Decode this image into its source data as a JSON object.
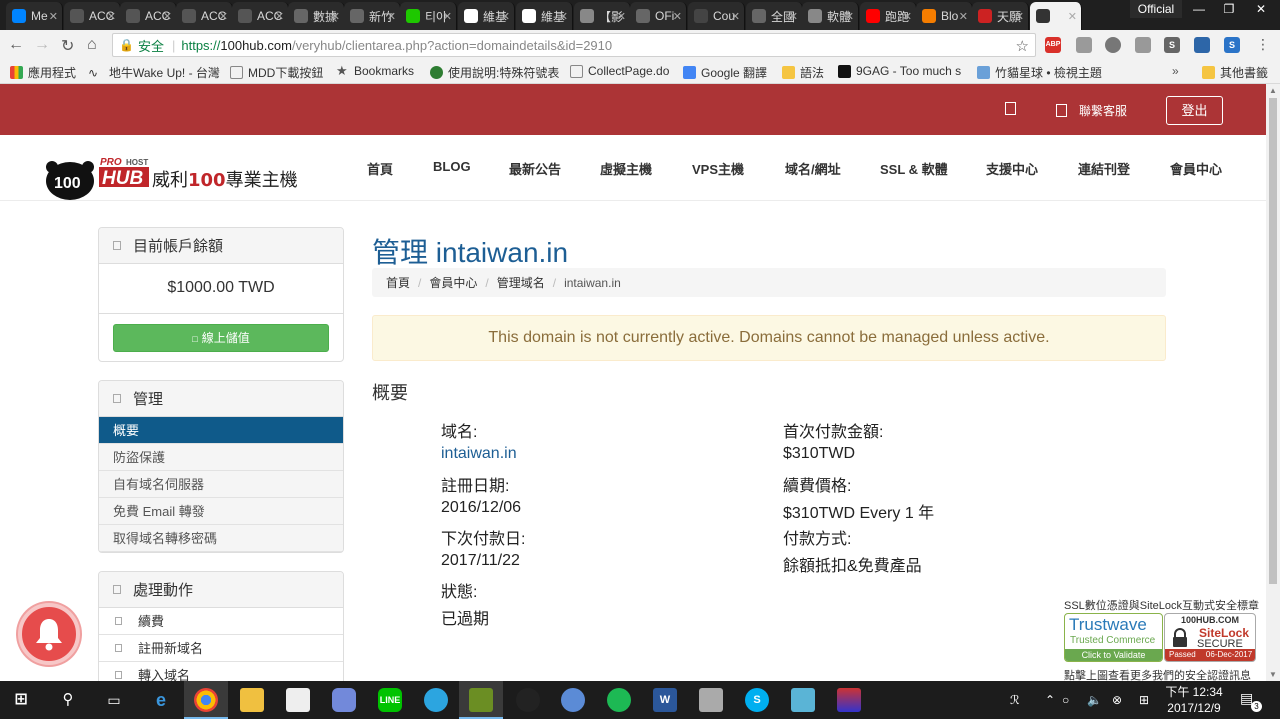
{
  "browser": {
    "tabs": [
      {
        "label": "Me",
        "icon": "messenger-icon",
        "color": "#0084ff"
      },
      {
        "label": "ACC",
        "icon": "chart-icon",
        "color": "#555555"
      },
      {
        "label": "ACC",
        "icon": "chart-icon",
        "color": "#555555"
      },
      {
        "label": "ACC",
        "icon": "chart-icon",
        "color": "#555555"
      },
      {
        "label": "ACC",
        "icon": "chart-icon",
        "color": "#555555"
      },
      {
        "label": "數據",
        "icon": "page-icon",
        "color": "#666666"
      },
      {
        "label": "新竹",
        "icon": "page-icon",
        "color": "#666666"
      },
      {
        "label": "티아",
        "icon": "naver-icon",
        "color": "#1ec800"
      },
      {
        "label": "維基",
        "icon": "wikipedia-icon",
        "color": "#ffffff"
      },
      {
        "label": "維基",
        "icon": "wikipedia-icon",
        "color": "#ffffff"
      },
      {
        "label": "【影",
        "icon": "radar-icon",
        "color": "#888888"
      },
      {
        "label": "OFi",
        "icon": "page-icon",
        "color": "#666666"
      },
      {
        "label": "Cou",
        "icon": "course-icon",
        "color": "#444444"
      },
      {
        "label": "全國",
        "icon": "page-icon",
        "color": "#666666"
      },
      {
        "label": "軟體",
        "icon": "image-icon",
        "color": "#888888"
      },
      {
        "label": "跑跑",
        "icon": "youtube-icon",
        "color": "#ff0000"
      },
      {
        "label": "Blo",
        "icon": "blogger-icon",
        "color": "#f57d00"
      },
      {
        "label": "天願",
        "icon": "star-icon",
        "color": "#cc2222"
      },
      {
        "label": "",
        "icon": "ninja-icon",
        "color": "#333333"
      }
    ],
    "profile_label": "Official",
    "secure_label": "安全",
    "url_proto": "https://",
    "url_host": "100hub.com",
    "url_path": "/veryhub/clientarea.php?action=domaindetails&id=2910",
    "extensions": [
      "ABP",
      "",
      "",
      "",
      "S",
      "",
      "S"
    ],
    "bookmarks": [
      "應用程式",
      "地牛Wake Up! - 台灣",
      "MDD下載按鈕",
      "Bookmarks",
      "使用說明:特殊符號表",
      "CollectPage.do",
      "Google 翻譯",
      "語法",
      "9GAG - Too much s",
      "竹貓星球 • 檢視主題",
      "其他書籤"
    ]
  },
  "site": {
    "top_links": {
      "contact": "聯繫客服",
      "logout": "登出"
    },
    "logo": {
      "pro": "PRO",
      "host": "HOST",
      "hub": "HUB",
      "brand_pre": "威利",
      "brand_num": "100",
      "brand_post": "專業主機",
      "num": "100"
    },
    "nav": [
      "首頁",
      "BLOG",
      "最新公告",
      "虛擬主機",
      "VPS主機",
      "域名/網址",
      "SSL & 軟體",
      "支援中心",
      "連結刊登",
      "會員中心"
    ],
    "sidebar": {
      "balance_title": "目前帳戶餘額",
      "balance_value": "$1000.00 TWD",
      "topup_label": "線上儲值",
      "manage_title": "管理",
      "manage_items": [
        "概要",
        "防盜保護",
        "自有域名伺服器",
        "免費 Email 轉發",
        "取得域名轉移密碼"
      ],
      "actions_title": "處理動作",
      "action_items": [
        "續費",
        "註冊新域名",
        "轉入域名"
      ]
    },
    "main": {
      "title": "管理 intaiwan.in",
      "breadcrumb": [
        "首頁",
        "會員中心",
        "管理域名",
        "intaiwan.in"
      ],
      "alert": "This domain is not currently active. Domains cannot be managed unless active.",
      "overview_title": "概要",
      "fields": {
        "domain_label": "域名:",
        "domain_value": "intaiwan.in",
        "regdate_label": "註冊日期:",
        "regdate_value": "2016/12/06",
        "nextdue_label": "下次付款日:",
        "nextdue_value": "2017/11/22",
        "status_label": "狀態:",
        "status_value": "已過期",
        "firstpay_label": "首次付款金額:",
        "firstpay_value": "$310TWD",
        "renew_label": "續費價格:",
        "renew_value": "$310TWD Every 1 年",
        "paymethod_label": "付款方式:",
        "paymethod_value": "餘額抵扣&免費產品"
      }
    },
    "seals": {
      "title": "SSL數位憑證與SiteLock互動式安全標章",
      "trustwave_name": "Trustwave",
      "trustwave_sub": "Trusted Commerce",
      "trustwave_cta": "Click to Validate",
      "sitelock_site": "100HUB.COM",
      "sitelock_name": "SiteLock",
      "sitelock_secure": "SECURE",
      "sitelock_passed": "Passed",
      "sitelock_date": "06-Dec-2017",
      "note": "點擊上圖查看更多我們的安全認證訊息"
    }
  },
  "taskbar": {
    "time": "下午 12:34",
    "date": "2017/12/9",
    "notifications": "3"
  }
}
